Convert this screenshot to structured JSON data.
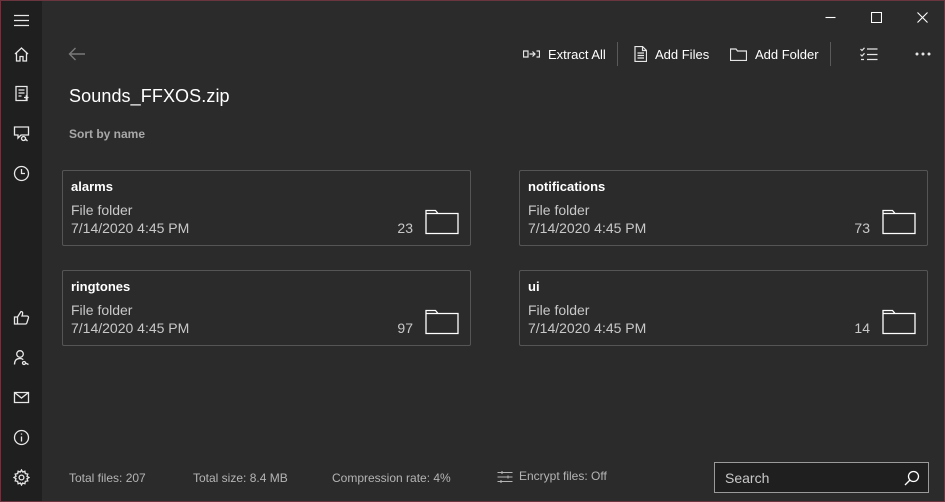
{
  "window": {
    "minimize_icon": "minimize-icon",
    "maximize_icon": "maximize-icon",
    "close_icon": "close-icon"
  },
  "sidebar": {
    "items": [
      {
        "icon": "hamburger-menu-icon"
      },
      {
        "icon": "home-icon"
      },
      {
        "icon": "new-archive-icon"
      },
      {
        "icon": "chat-search-icon"
      },
      {
        "icon": "recent-clock-icon"
      },
      {
        "icon": "thumbs-up-icon"
      },
      {
        "icon": "account-icon"
      },
      {
        "icon": "mail-icon"
      },
      {
        "icon": "info-icon"
      },
      {
        "icon": "settings-gear-icon"
      }
    ]
  },
  "toolbar": {
    "extract_all_label": "Extract All",
    "add_files_label": "Add Files",
    "add_folder_label": "Add Folder"
  },
  "archive": {
    "title": "Sounds_FFXOS.zip",
    "sort_label": "Sort by name"
  },
  "items": [
    {
      "name": "alarms",
      "type": "File folder",
      "date": "7/14/2020 4:45 PM",
      "count": "23"
    },
    {
      "name": "notifications",
      "type": "File folder",
      "date": "7/14/2020 4:45 PM",
      "count": "73"
    },
    {
      "name": "ringtones",
      "type": "File folder",
      "date": "7/14/2020 4:45 PM",
      "count": "97"
    },
    {
      "name": "ui",
      "type": "File folder",
      "date": "7/14/2020 4:45 PM",
      "count": "14"
    }
  ],
  "status": {
    "total_files": "Total files: 207",
    "total_size": "Total size: 8.4 MB",
    "compression_rate": "Compression rate: 4%",
    "encrypt_files": "Encrypt files: Off"
  },
  "search": {
    "placeholder": "Search"
  },
  "colors": {
    "background": "#2b2b2b",
    "sidebar": "#1f1f1f",
    "window_border": "#6b3540",
    "card_border": "#555555",
    "secondary_text": "#c8c8c8"
  }
}
